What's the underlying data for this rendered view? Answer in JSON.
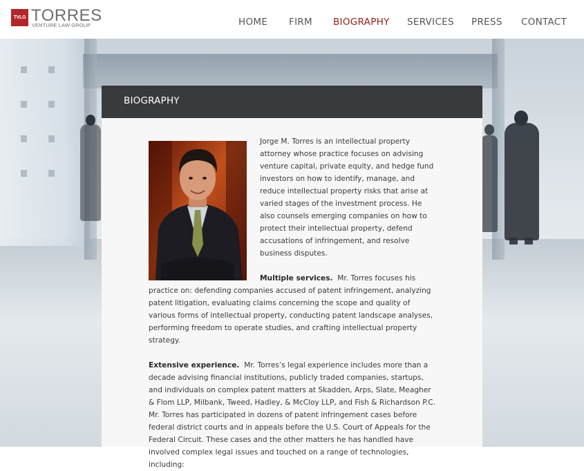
{
  "header": {
    "logo_mark": "TVLG",
    "logo_name": "TORRES",
    "logo_tagline": "VENTURE LAW GROUP",
    "nav": [
      {
        "label": "HOME",
        "active": false
      },
      {
        "label": "FIRM",
        "active": false
      },
      {
        "label": "BIOGRAPHY",
        "active": true
      },
      {
        "label": "SERVICES",
        "active": false
      },
      {
        "label": "PRESS",
        "active": false
      },
      {
        "label": "CONTACT",
        "active": false
      }
    ]
  },
  "panel": {
    "title": "BIOGRAPHY",
    "intro": "Jorge M. Torres is an intellectual property attorney whose practice focuses on advising venture capital, private equity, and hedge fund investors on how to identify, manage, and reduce intellectual property risks that arise at varied stages of the investment process. He also counsels emerging companies on how to protect their intellectual property, defend accusations of infringement, and resolve business disputes.",
    "services_heading": "Multiple services.",
    "services_text": "Mr. Torres focuses his practice on:  defending companies accused of patent infringement, analyzing patent litigation, evaluating claims concerning the scope and quality of various forms of intellectual property, conducting patent landscape analyses, performing freedom to operate studies, and crafting intellectual property strategy.",
    "experience_heading": "Extensive experience.",
    "experience_text": "Mr. Torres’s legal experience includes more than a decade advising financial institutions, publicly traded companies, startups, and individuals on complex patent matters at Skadden, Arps, Slate, Meagher & Flom LLP, Milbank, Tweed, Hadley, & McCloy LLP, and Fish & Richardson P.C.  Mr. Torres has participated in dozens of patent infringement cases before federal district courts and in appeals before the U.S. Court of Appeals for the Federal Circuit. These cases and the other matters he has handled have involved complex legal issues and touched on a range of technologies, including:"
  },
  "colors": {
    "brand_red": "#b3262a",
    "nav_active": "#9b1b1f",
    "nav_text": "#555555",
    "panel_header": "#232326",
    "panel_body": "#f7f7f7"
  }
}
